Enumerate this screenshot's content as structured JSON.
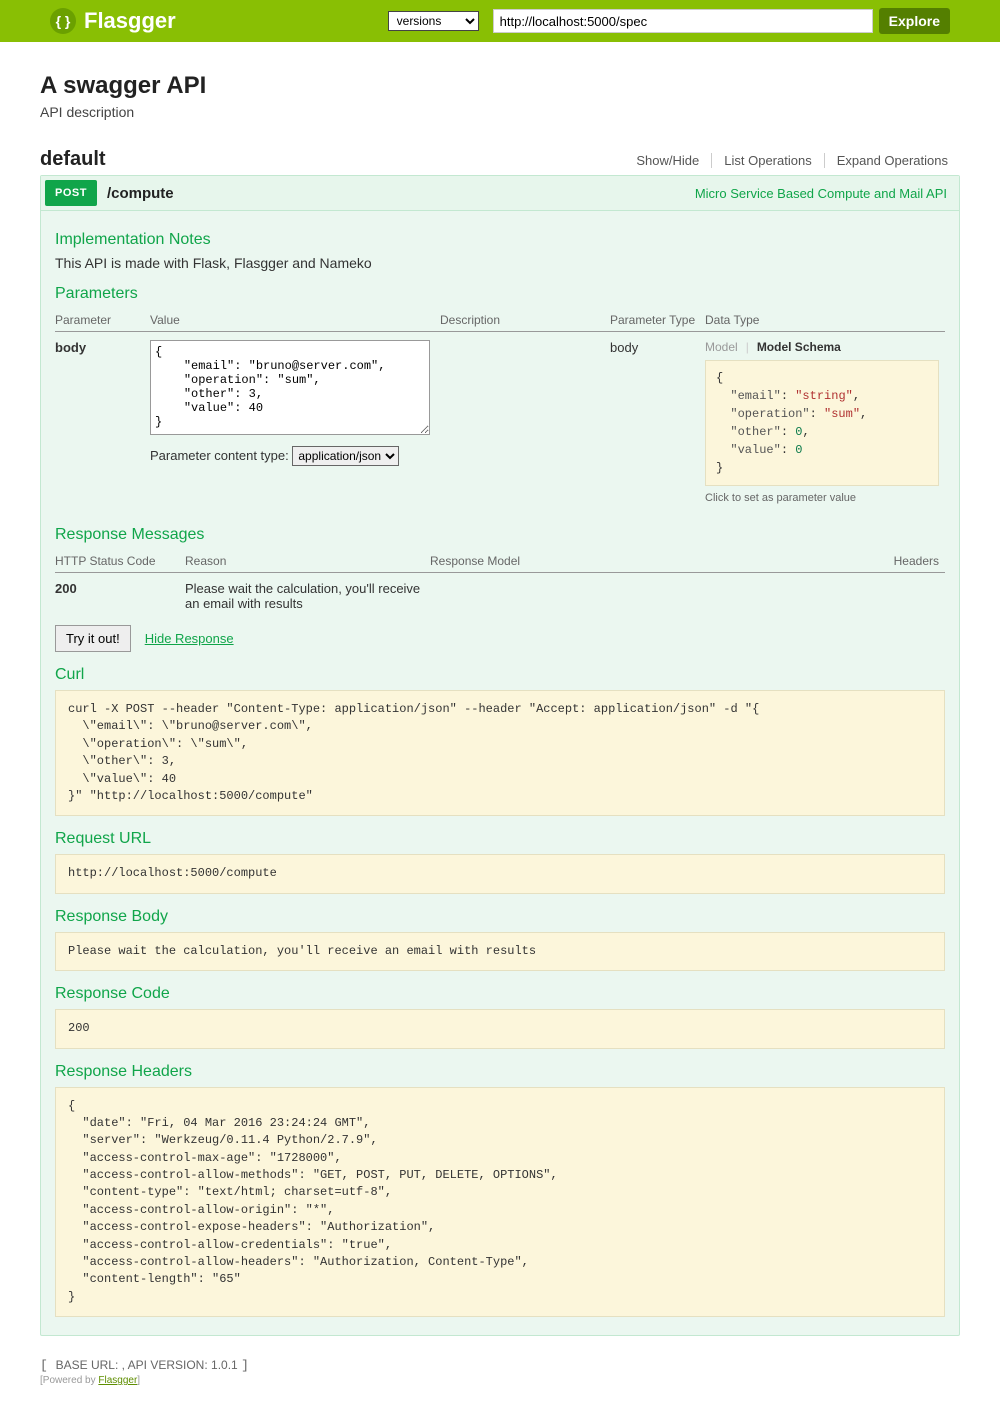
{
  "nav": {
    "brand": "Flasgger",
    "select_value": "versions",
    "spec_url": "http://localhost:5000/spec",
    "explore": "Explore"
  },
  "api": {
    "title": "A swagger API",
    "desc": "API description"
  },
  "tag": {
    "name": "default",
    "actions": {
      "show": "Show/Hide",
      "list": "List Operations",
      "expand": "Expand Operations"
    }
  },
  "op": {
    "method": "POST",
    "path": "/compute",
    "summary": "Micro Service Based Compute and Mail API",
    "impl_h": "Implementation Notes",
    "impl_text": "This API is made with Flask, Flasgger and Nameko",
    "params_h": "Parameters",
    "param_th": {
      "name": "Parameter",
      "value": "Value",
      "desc": "Description",
      "ptype": "Parameter Type",
      "dtype": "Data Type"
    },
    "param": {
      "name": "body",
      "value": "{\n    \"email\": \"bruno@server.com\",\n    \"operation\": \"sum\",\n    \"other\": 3,\n    \"value\": 40\n}",
      "ptype": "body",
      "content_type_label": "Parameter content type:",
      "content_type": "application/json"
    },
    "schema_tabs": {
      "model": "Model",
      "model_schema": "Model Schema"
    },
    "schema_hint": "Click to set as parameter value",
    "schema": {
      "email_v": "\"string\"",
      "operation_v": "\"sum\"",
      "other_v": "0",
      "value_v": "0"
    },
    "resp_h": "Response Messages",
    "resp_th": {
      "code": "HTTP Status Code",
      "reason": "Reason",
      "model": "Response Model",
      "headers": "Headers"
    },
    "resp": {
      "code": "200",
      "reason": "Please wait the calculation, you'll receive an email with results"
    },
    "try_btn": "Try it out!",
    "hide_link": "Hide Response",
    "curl_h": "Curl",
    "curl": "curl -X POST --header \"Content-Type: application/json\" --header \"Accept: application/json\" -d \"{\n  \\\"email\\\": \\\"bruno@server.com\\\",\n  \\\"operation\\\": \\\"sum\\\",\n  \\\"other\\\": 3,\n  \\\"value\\\": 40\n}\" \"http://localhost:5000/compute\"",
    "req_url_h": "Request URL",
    "req_url": "http://localhost:5000/compute",
    "resp_body_h": "Response Body",
    "resp_body": "Please wait the calculation, you'll receive an email with results",
    "resp_code_h": "Response Code",
    "resp_code": "200",
    "resp_headers_h": "Response Headers",
    "resp_headers": "{\n  \"date\": \"Fri, 04 Mar 2016 23:24:24 GMT\",\n  \"server\": \"Werkzeug/0.11.4 Python/2.7.9\",\n  \"access-control-max-age\": \"1728000\",\n  \"access-control-allow-methods\": \"GET, POST, PUT, DELETE, OPTIONS\",\n  \"content-type\": \"text/html; charset=utf-8\",\n  \"access-control-allow-origin\": \"*\",\n  \"access-control-expose-headers\": \"Authorization\",\n  \"access-control-allow-credentials\": \"true\",\n  \"access-control-allow-headers\": \"Authorization, Content-Type\",\n  \"content-length\": \"65\"\n}"
  },
  "footer": {
    "base_url_label": "BASE URL:",
    "base_url_value": " ",
    "api_ver_label": ", API VERSION:",
    "api_ver_value": "1.0.1",
    "powered": "Powered by ",
    "powered_link": "Flasgger"
  }
}
